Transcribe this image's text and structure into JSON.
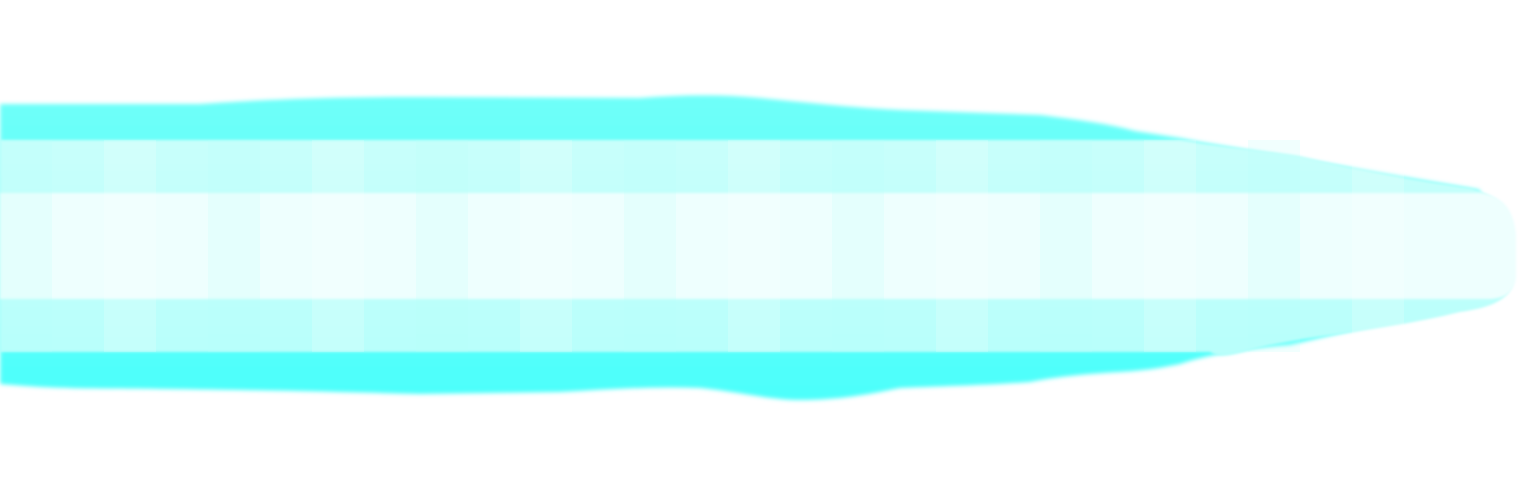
{
  "artwork": {
    "subject": "cyan-glow-beam",
    "colors": {
      "background": "#ffffff",
      "outer_glow": "#4dfffb",
      "outer_glow_top": "#6ffff9",
      "middle_band": "#b8fffb",
      "middle_band_top": "#c8fffb",
      "core": "#eefffe"
    }
  }
}
